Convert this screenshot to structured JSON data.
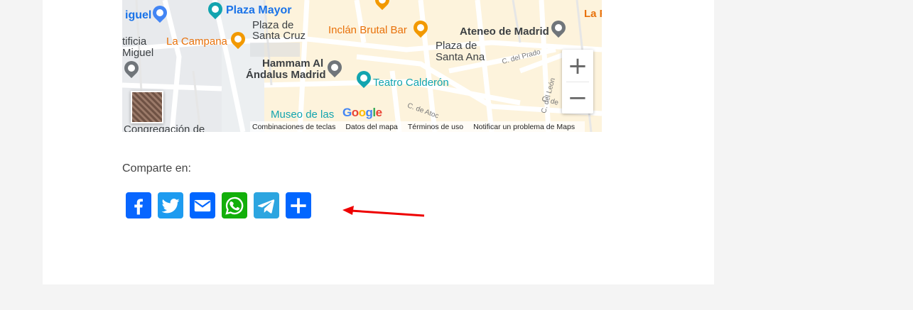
{
  "map": {
    "labels": {
      "plaza_mayor": "Plaza Mayor",
      "plaza_santa_cruz_1": "Plaza de",
      "plaza_santa_cruz_2": "Santa Cruz",
      "inclan": "Inclán Brutal Bar",
      "ateneo": "Ateneo de Madrid",
      "la_partial": "La F",
      "la_campana": "La Campana",
      "plaza_santa_ana_1": "Plaza de",
      "plaza_santa_ana_2": "Santa Ana",
      "hammam_1": "Hammam Al",
      "hammam_2": "Ándalus Madrid",
      "teatro": "Teatro Calderón",
      "museo": "Museo de las",
      "miguel_partial": "iguel",
      "tificia": "tificia",
      "miguel2": "Miguel",
      "congregacion": "Congregación de",
      "c_prado": "C. del Prado",
      "c_atocha": "C. de Atoc",
      "c_leon": "C. del León",
      "c_de": "C. de"
    },
    "zoom_in": "+",
    "zoom_out": "−",
    "google_logo": [
      "G",
      "o",
      "o",
      "g",
      "l",
      "e"
    ],
    "footer": {
      "shortcuts": "Combinaciones de teclas",
      "map_data": "Datos del mapa",
      "terms": "Términos de uso",
      "report": "Notificar un problema de Maps"
    }
  },
  "share": {
    "label": "Comparte en:",
    "buttons": [
      {
        "name": "Facebook",
        "color": "#0866ff",
        "icon": "facebook-icon"
      },
      {
        "name": "Twitter",
        "color": "#1d9bf0",
        "icon": "twitter-icon"
      },
      {
        "name": "Email",
        "color": "#0166ff",
        "icon": "email-icon"
      },
      {
        "name": "WhatsApp",
        "color": "#12af0a",
        "icon": "whatsapp-icon"
      },
      {
        "name": "Telegram",
        "color": "#2ca5e0",
        "icon": "telegram-icon"
      },
      {
        "name": "Share",
        "color": "#0166ff",
        "icon": "plus-icon"
      }
    ]
  },
  "annotation": {
    "color": "#ee0000",
    "icon": "red-arrow-icon"
  }
}
